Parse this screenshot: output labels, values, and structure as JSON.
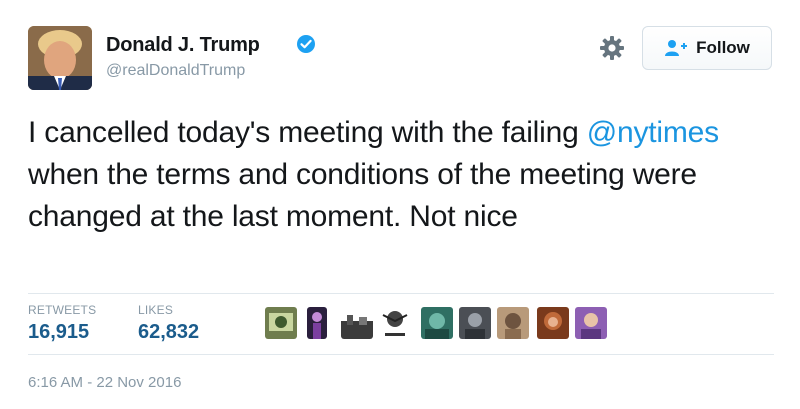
{
  "author": {
    "name": "Donald J. Trump",
    "handle": "@realDonaldTrump",
    "verified": true,
    "verified_icon": "verified-badge-icon",
    "avatar_icon": "profile-photo"
  },
  "actions": {
    "settings_icon": "gear-icon",
    "follow_label": "Follow",
    "follow_icon": "add-user-icon"
  },
  "tweet": {
    "text_before": "I cancelled today's meeting with the failing ",
    "mention": "@nytimes",
    "text_after": " when the terms and conditions of the meeting were changed at the last moment. Not nice"
  },
  "stats": {
    "retweets_label": "RETWEETS",
    "retweets_value": "16,915",
    "likes_label": "LIKES",
    "likes_value": "62,832"
  },
  "likers_count_shown": 9,
  "timestamp": "6:16 AM - 22 Nov 2016",
  "colors": {
    "link": "#1b95e0",
    "verified": "#1da1f2",
    "muted": "#8899a6",
    "stat_value": "#1b5c8c"
  }
}
